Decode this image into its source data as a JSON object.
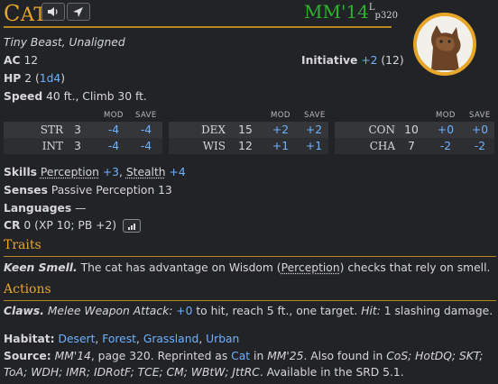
{
  "header": {
    "name_initial": "C",
    "name_rest": "AT",
    "source_abbr": "MM'14",
    "source_sup": "L",
    "source_page": "p320"
  },
  "meta": {
    "size_type": "Tiny Beast, Unaligned",
    "ac_label": "AC",
    "ac_value": "12",
    "initiative_label": "Initiative",
    "initiative_mod": "+2",
    "initiative_score": "(12)",
    "hp_label": "HP",
    "hp_value": "2",
    "hp_dice": "1d4",
    "speed_label": "Speed",
    "speed_value": "40 ft., Climb 30 ft."
  },
  "stat_headers": {
    "mod": "MOD",
    "save": "SAVE"
  },
  "stats": [
    {
      "name": "STR",
      "score": "3",
      "mod": "-4",
      "save": "-4"
    },
    {
      "name": "INT",
      "score": "3",
      "mod": "-4",
      "save": "-4"
    },
    {
      "name": "DEX",
      "score": "15",
      "mod": "+2",
      "save": "+2"
    },
    {
      "name": "WIS",
      "score": "12",
      "mod": "+1",
      "save": "+1"
    },
    {
      "name": "CON",
      "score": "10",
      "mod": "+0",
      "save": "+0"
    },
    {
      "name": "CHA",
      "score": "7",
      "mod": "-2",
      "save": "-2"
    }
  ],
  "details": {
    "skills_label": "Skills",
    "skill1_name": "Perception",
    "skill1_mod": "+3",
    "skill2_name": "Stealth",
    "skill2_mod": "+4",
    "senses_label": "Senses",
    "senses_value": "Passive Perception 13",
    "languages_label": "Languages",
    "languages_value": "—",
    "cr_label": "CR",
    "cr_value": "0 (XP 10; PB +2)"
  },
  "traits": {
    "heading": "Traits",
    "trait_name": "Keen Smell.",
    "text_a": "The cat has advantage on Wisdom (",
    "text_link": "Perception",
    "text_b": ") checks that rely on smell."
  },
  "actions": {
    "heading": "Actions",
    "action_name": "Claws.",
    "attack_type": "Melee Weapon Attack:",
    "to_hit": "+0",
    "text_a": "to hit, reach 5 ft., one target.",
    "hit_label": "Hit:",
    "damage": "1 slashing damage."
  },
  "footer": {
    "habitat_label": "Habitat:",
    "habitats": [
      "Desert",
      "Forest",
      "Grassland",
      "Urban"
    ],
    "source_label": "Source:",
    "source_book": "MM'14",
    "source_text_a": ", page 320. Reprinted as",
    "reprint_link": "Cat",
    "source_text_b": "in",
    "reprint_book": "MM'25",
    "source_text_c": ". Also found in",
    "also_found_1": "CoS; HotDQ; SKT;",
    "also_found_2": "ToA; WDH; IMR; IDRotF; TCE; CM; WBtW; JttRC",
    "source_text_d": ". Available in the SRD 5.1."
  }
}
